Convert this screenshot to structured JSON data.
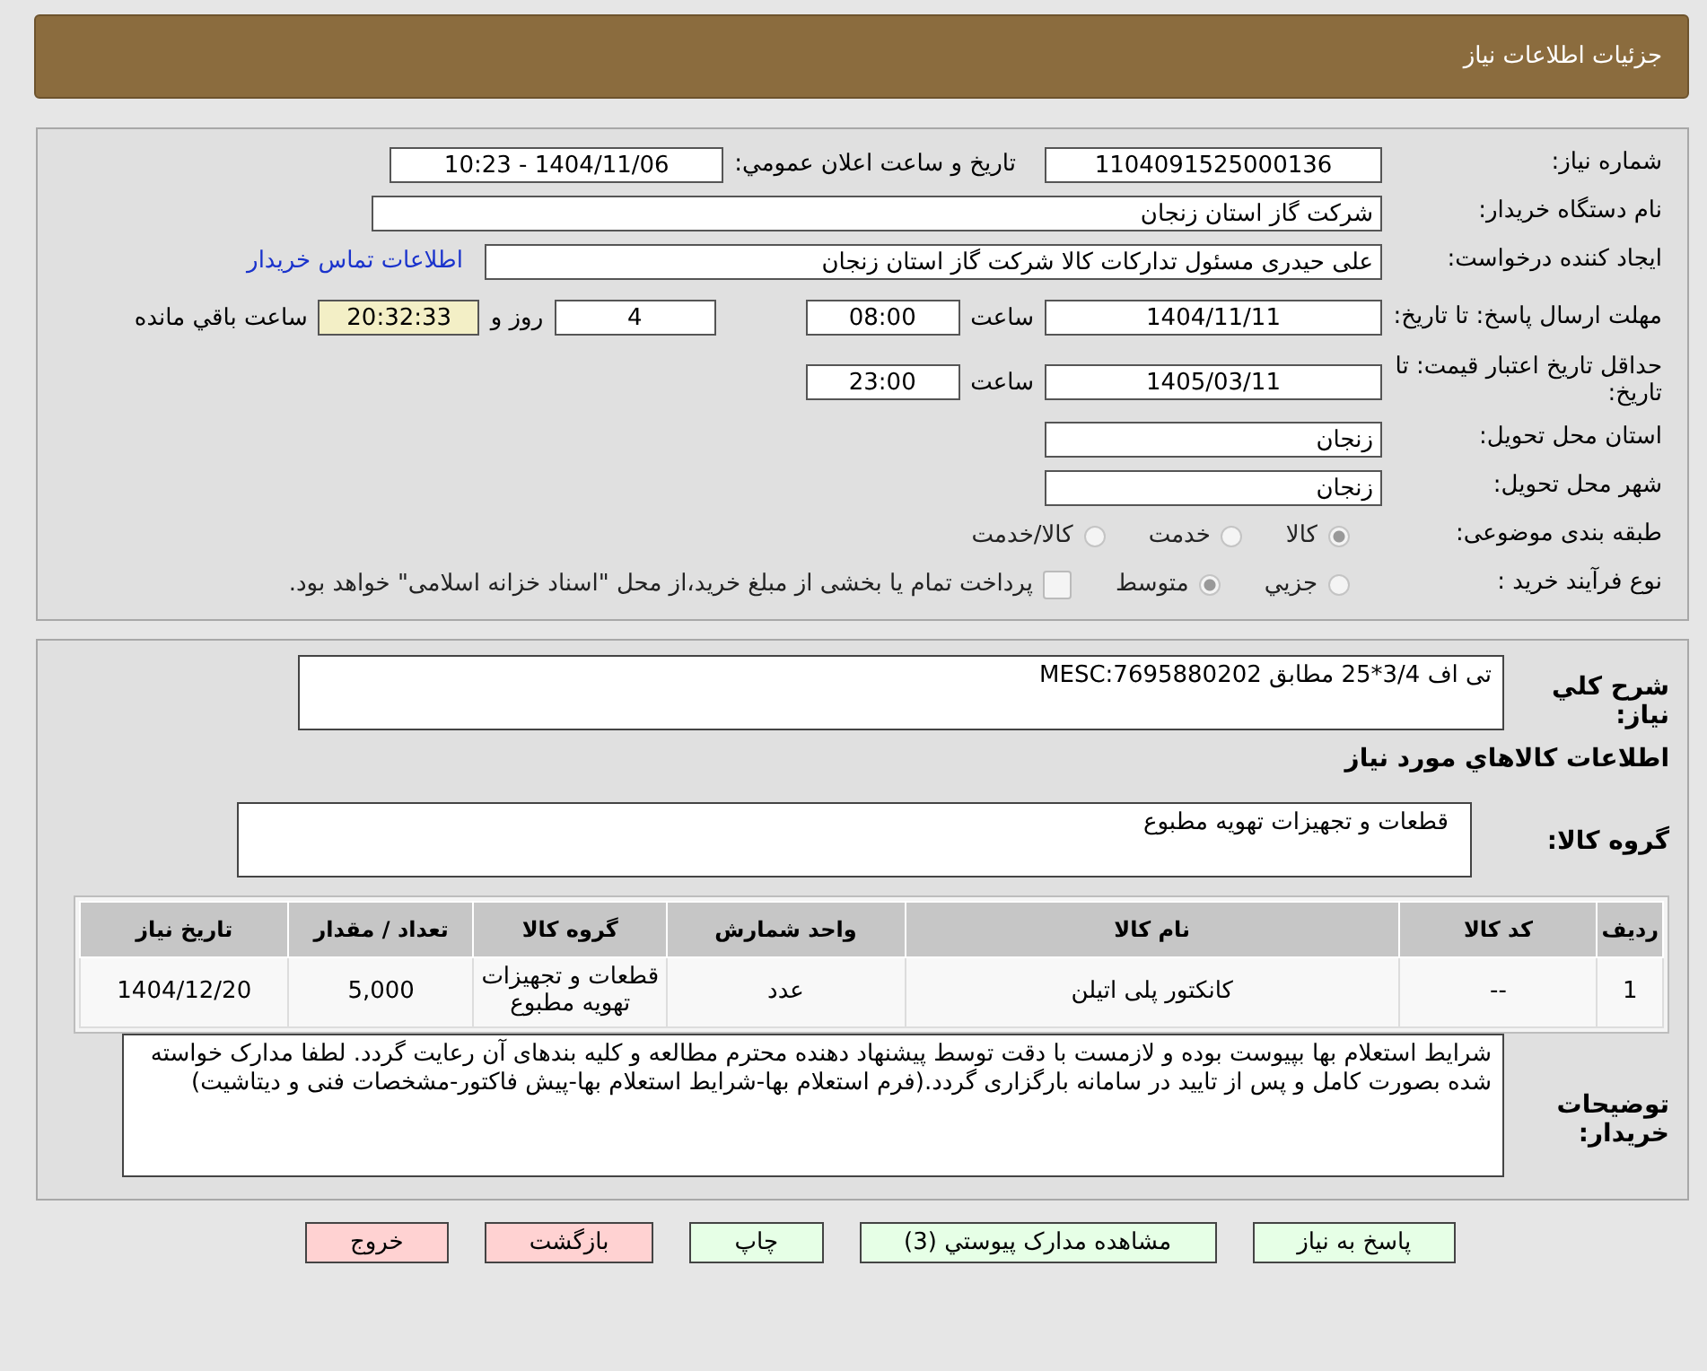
{
  "header": {
    "title": "جزئیات اطلاعات نیاز"
  },
  "info": {
    "need_number": {
      "label": "شماره نیاز:",
      "value": "1104091525000136"
    },
    "announce": {
      "label": "تاریخ و ساعت اعلان عمومي:",
      "value": "1404/11/06 - 10:23"
    },
    "buyer": {
      "label": "نام دستگاه خریدار:",
      "value": "شرکت گاز استان زنجان"
    },
    "creator": {
      "label": "ایجاد کننده درخواست:",
      "value": "علی حیدری مسئول تدارکات کالا شرکت گاز استان زنجان",
      "link": "اطلاعات تماس خریدار"
    },
    "deadline": {
      "label": "مهلت ارسال پاسخ: تا تاریخ:",
      "date": "1404/11/11",
      "time_label": "ساعت",
      "time": "08:00",
      "days": "4",
      "days_label": "روز و",
      "remaining": "20:32:33",
      "remaining_label": "ساعت باقي مانده"
    },
    "validity": {
      "label": "حداقل تاریخ اعتبار قیمت: تا تاریخ:",
      "date": "1405/03/11",
      "time_label": "ساعت",
      "time": "23:00"
    },
    "province": {
      "label": "استان محل تحویل:",
      "value": "زنجان"
    },
    "city": {
      "label": "شهر محل تحویل:",
      "value": "زنجان"
    },
    "category": {
      "label": "طبقه بندی موضوعی:",
      "options": [
        {
          "label": "کالا",
          "selected": true
        },
        {
          "label": "خدمت",
          "selected": false
        },
        {
          "label": "کالا/خدمت",
          "selected": false
        }
      ]
    },
    "process": {
      "label": "نوع فرآیند خرید :",
      "options": [
        {
          "label": "جزيي",
          "selected": false
        },
        {
          "label": "متوسط",
          "selected": true
        }
      ],
      "treasury": {
        "checked": false,
        "label": "پرداخت تمام یا بخشی از مبلغ خرید،از محل \"اسناد خزانه اسلامی\" خواهد بود."
      }
    }
  },
  "details": {
    "summary_label": "شرح کلي نیاز:",
    "summary": "تی اف 3/4*25 مطابق MESC:7695880202",
    "goods_title": "اطلاعات کالاهاي مورد نياز",
    "group_label": "گروه کالا:",
    "group": "قطعات و تجهیزات تهویه مطبوع",
    "table": {
      "columns": [
        "ردیف",
        "کد کالا",
        "نام کالا",
        "واحد شمارش",
        "گروه کالا",
        "تعداد / مقدار",
        "تاریخ نیاز"
      ],
      "rows": [
        [
          "1",
          "--",
          "کانکتور پلی اتیلن",
          "عدد",
          "قطعات و تجهیزات تهویه مطبوع",
          "5,000",
          "1404/12/20"
        ]
      ]
    },
    "notes_label": "توضیحات خریدار:",
    "notes": "شرایط استعلام بها بپیوست بوده و لازمست با دقت توسط پیشنهاد دهنده محترم مطالعه و کلیه بندهای آن رعایت گردد. لطفا مدارک خواسته شده بصورت کامل و پس از تایید در سامانه بارگزاری گردد.(فرم استعلام بها-شرایط استعلام بها-پیش فاکتور-مشخصات فنی و دیتاشیت)"
  },
  "buttons": [
    {
      "label": "پاسخ به نیاز",
      "kind": "primary"
    },
    {
      "label": "مشاهده مدارک پیوستي (3)",
      "kind": "primary"
    },
    {
      "label": "چاپ",
      "kind": "primary"
    },
    {
      "label": "بازگشت",
      "kind": "danger"
    },
    {
      "label": "خروج",
      "kind": "danger"
    }
  ]
}
